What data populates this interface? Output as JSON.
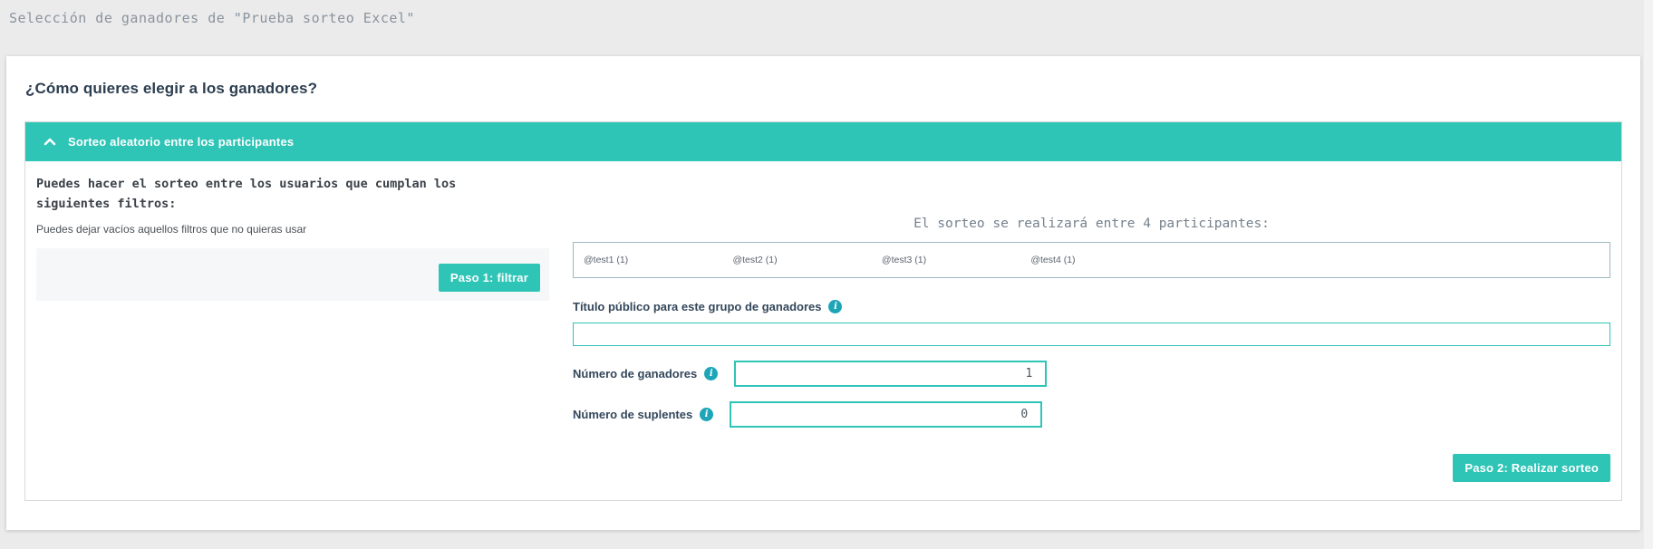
{
  "header": {
    "title": "Selección de ganadores de \"Prueba sorteo Excel\""
  },
  "card": {
    "question_title": "¿Cómo quieres elegir a los ganadores?",
    "panel": {
      "header_label": "Sorteo aleatorio entre los participantes",
      "chevron_icon": "chevron-up-icon"
    },
    "filters": {
      "intro_bold": "Puedes hacer el sorteo entre los usuarios que cumplan los siguientes filtros:",
      "intro_hint": "Puedes dejar vacíos aquellos filtros que no quieras usar",
      "step1_button_label": "Paso 1: filtrar"
    },
    "draw": {
      "participants_heading": "El sorteo se realizará entre 4 participantes:",
      "participants": [
        "@test1 (1)",
        "@test2 (1)",
        "@test3 (1)",
        "@test4 (1)"
      ],
      "public_title_label": "Título público para este grupo de ganadores",
      "public_title_value": "",
      "winners_label": "Número de ganadores",
      "winners_value": "1",
      "substitutes_label": "Número de suplentes",
      "substitutes_value": "0",
      "step2_button_label": "Paso 2: Realizar sorteo",
      "info_icon_glyph": "i"
    }
  },
  "colors": {
    "accent": "#2EC4B6",
    "info_icon": "#1EA5B8",
    "page_background": "#ebebeb"
  }
}
